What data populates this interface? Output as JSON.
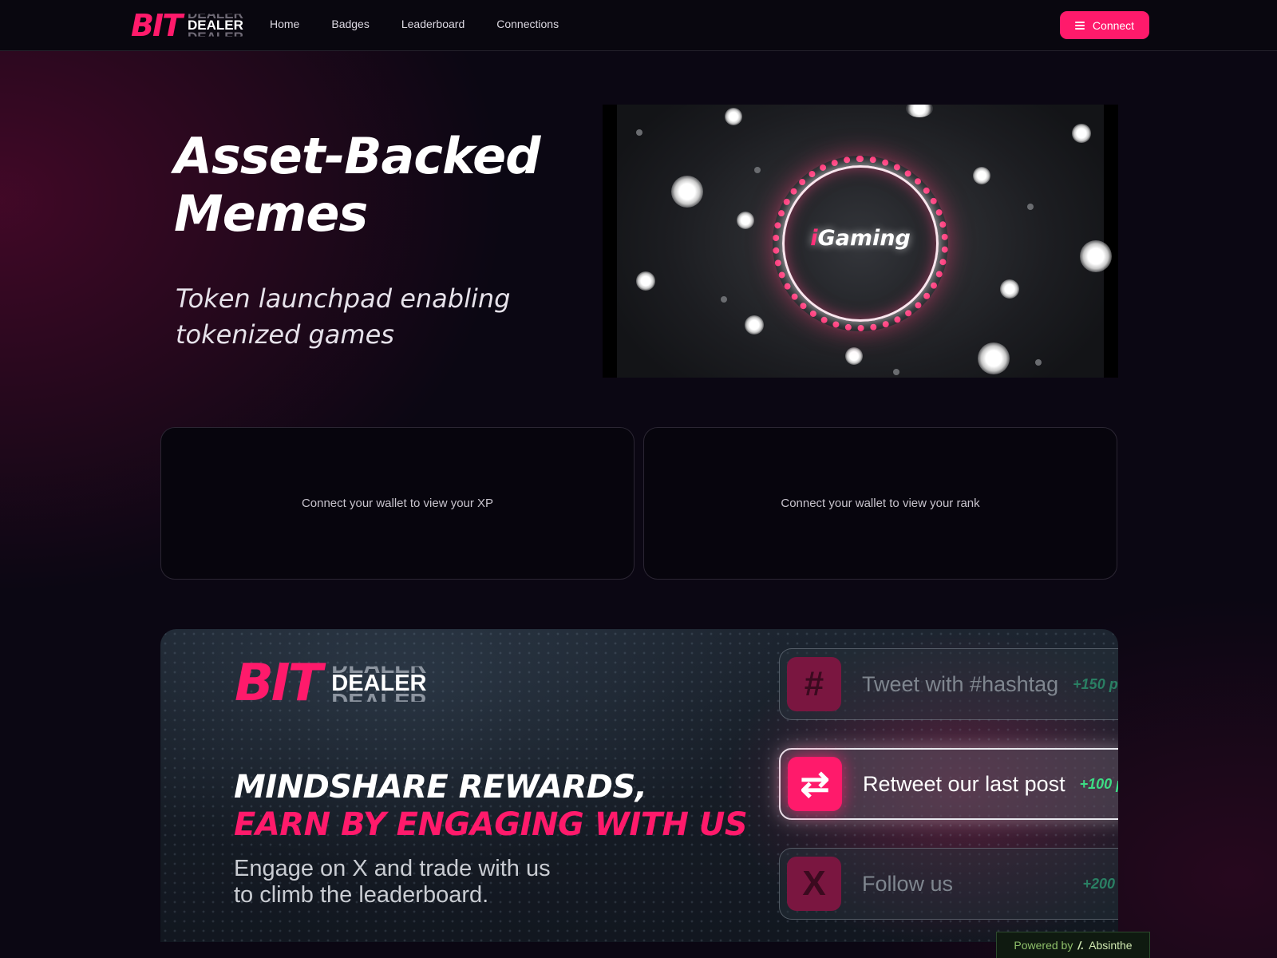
{
  "nav": {
    "logo_bit": "BIT",
    "logo_dealer": "DEALER",
    "links": [
      "Home",
      "Badges",
      "Leaderboard",
      "Connections"
    ],
    "connect_label": "Connect"
  },
  "hero": {
    "title_line1": "Asset-Backed",
    "title_line2": "Memes",
    "subtitle_line1": "Token launchpad enabling",
    "subtitle_line2": "tokenized games",
    "video_text_i": "i",
    "video_text_rest": "Gaming"
  },
  "cards": {
    "xp_text": "Connect your wallet to view your XP",
    "rank_text": "Connect your wallet to view your rank"
  },
  "banner": {
    "logo_bit": "BIT",
    "logo_dealer": "DEALER",
    "heading_line1": "MINDSHARE REWARDS,",
    "heading_line2": "EARN BY ENGAGING WITH US",
    "sub_line1": "Engage on X and trade with us",
    "sub_line2": "to climb the leaderboard.",
    "tasks": [
      {
        "icon": "hashtag-icon",
        "glyph": "#",
        "label": "Tweet with #hashtag",
        "points": "+150 p"
      },
      {
        "icon": "retweet-icon",
        "glyph": "⇄",
        "label": "Retweet our last post",
        "points": "+100 p"
      },
      {
        "icon": "x-logo-icon",
        "glyph": "X",
        "label": "Follow us",
        "points": "+200"
      }
    ]
  },
  "footer": {
    "powered_by": "Powered by",
    "brand_mark": "/.",
    "brand": "Absinthe"
  },
  "colors": {
    "accent": "#ff1a6b",
    "background": "#0b0713",
    "points_green": "#3ddc84"
  }
}
